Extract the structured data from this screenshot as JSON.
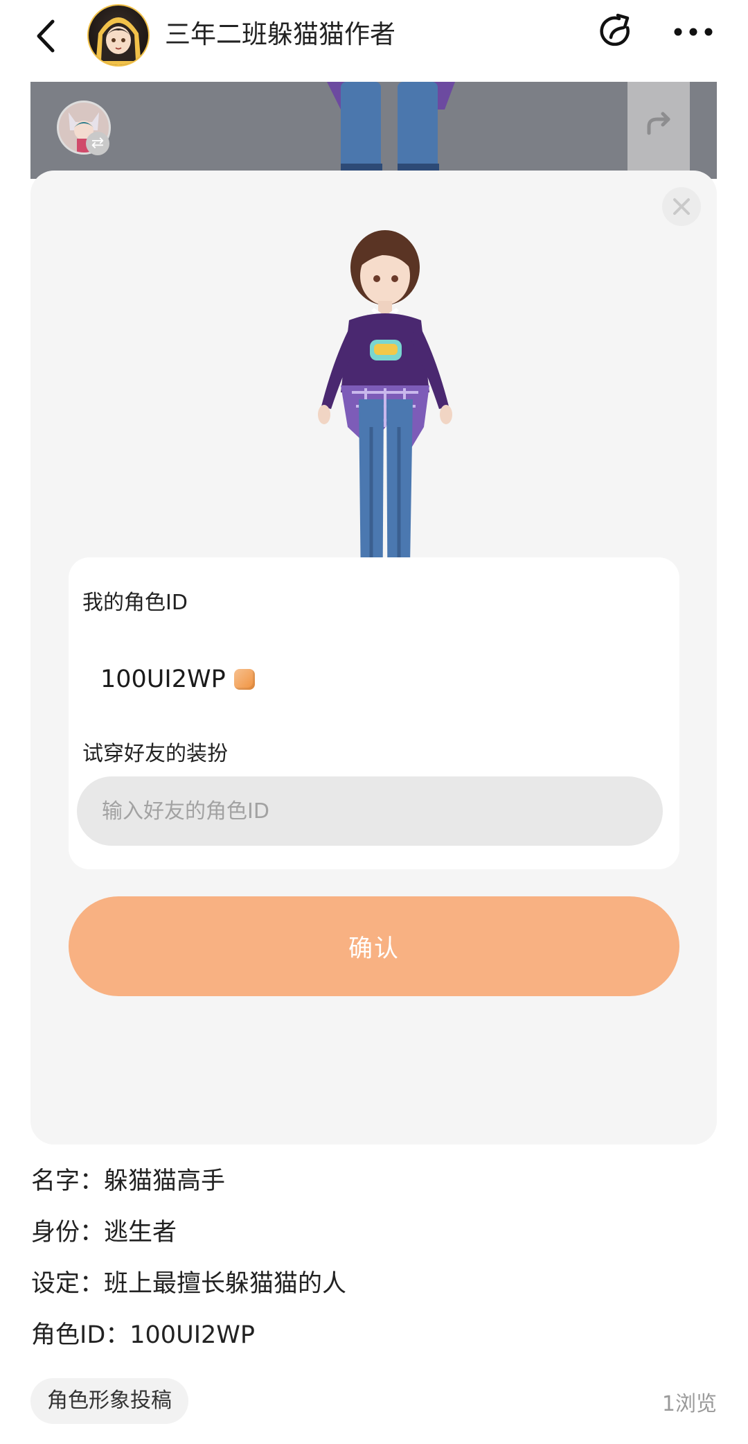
{
  "header": {
    "author_name": "三年二班躲猫猫作者"
  },
  "modal": {
    "my_id_label": "我的角色ID",
    "my_id_value": "100UI2WP",
    "try_on_label": "试穿好友的装扮",
    "friend_id_placeholder": "输入好友的角色ID",
    "friend_id_value": "",
    "confirm_label": "确认"
  },
  "character_info": {
    "name_line": "名字：躲猫猫高手",
    "identity_line": "身份：逃生者",
    "setting_line": "设定：班上最擅长躲猫猫的人",
    "id_line": "角色ID：100UI2WP"
  },
  "footer": {
    "tag_label": "角色形象投稿",
    "views_label": "1浏览"
  },
  "colors": {
    "accent": "#f8b182",
    "copy_icon": "#f1913c",
    "modal_bg": "#f5f5f5",
    "input_bg": "#e8e8e8"
  },
  "icons": [
    "back-arrow-icon",
    "author-avatar",
    "share-icon",
    "more-icon",
    "switch-avatar-icon",
    "redo-icon",
    "close-icon",
    "copy-icon"
  ]
}
